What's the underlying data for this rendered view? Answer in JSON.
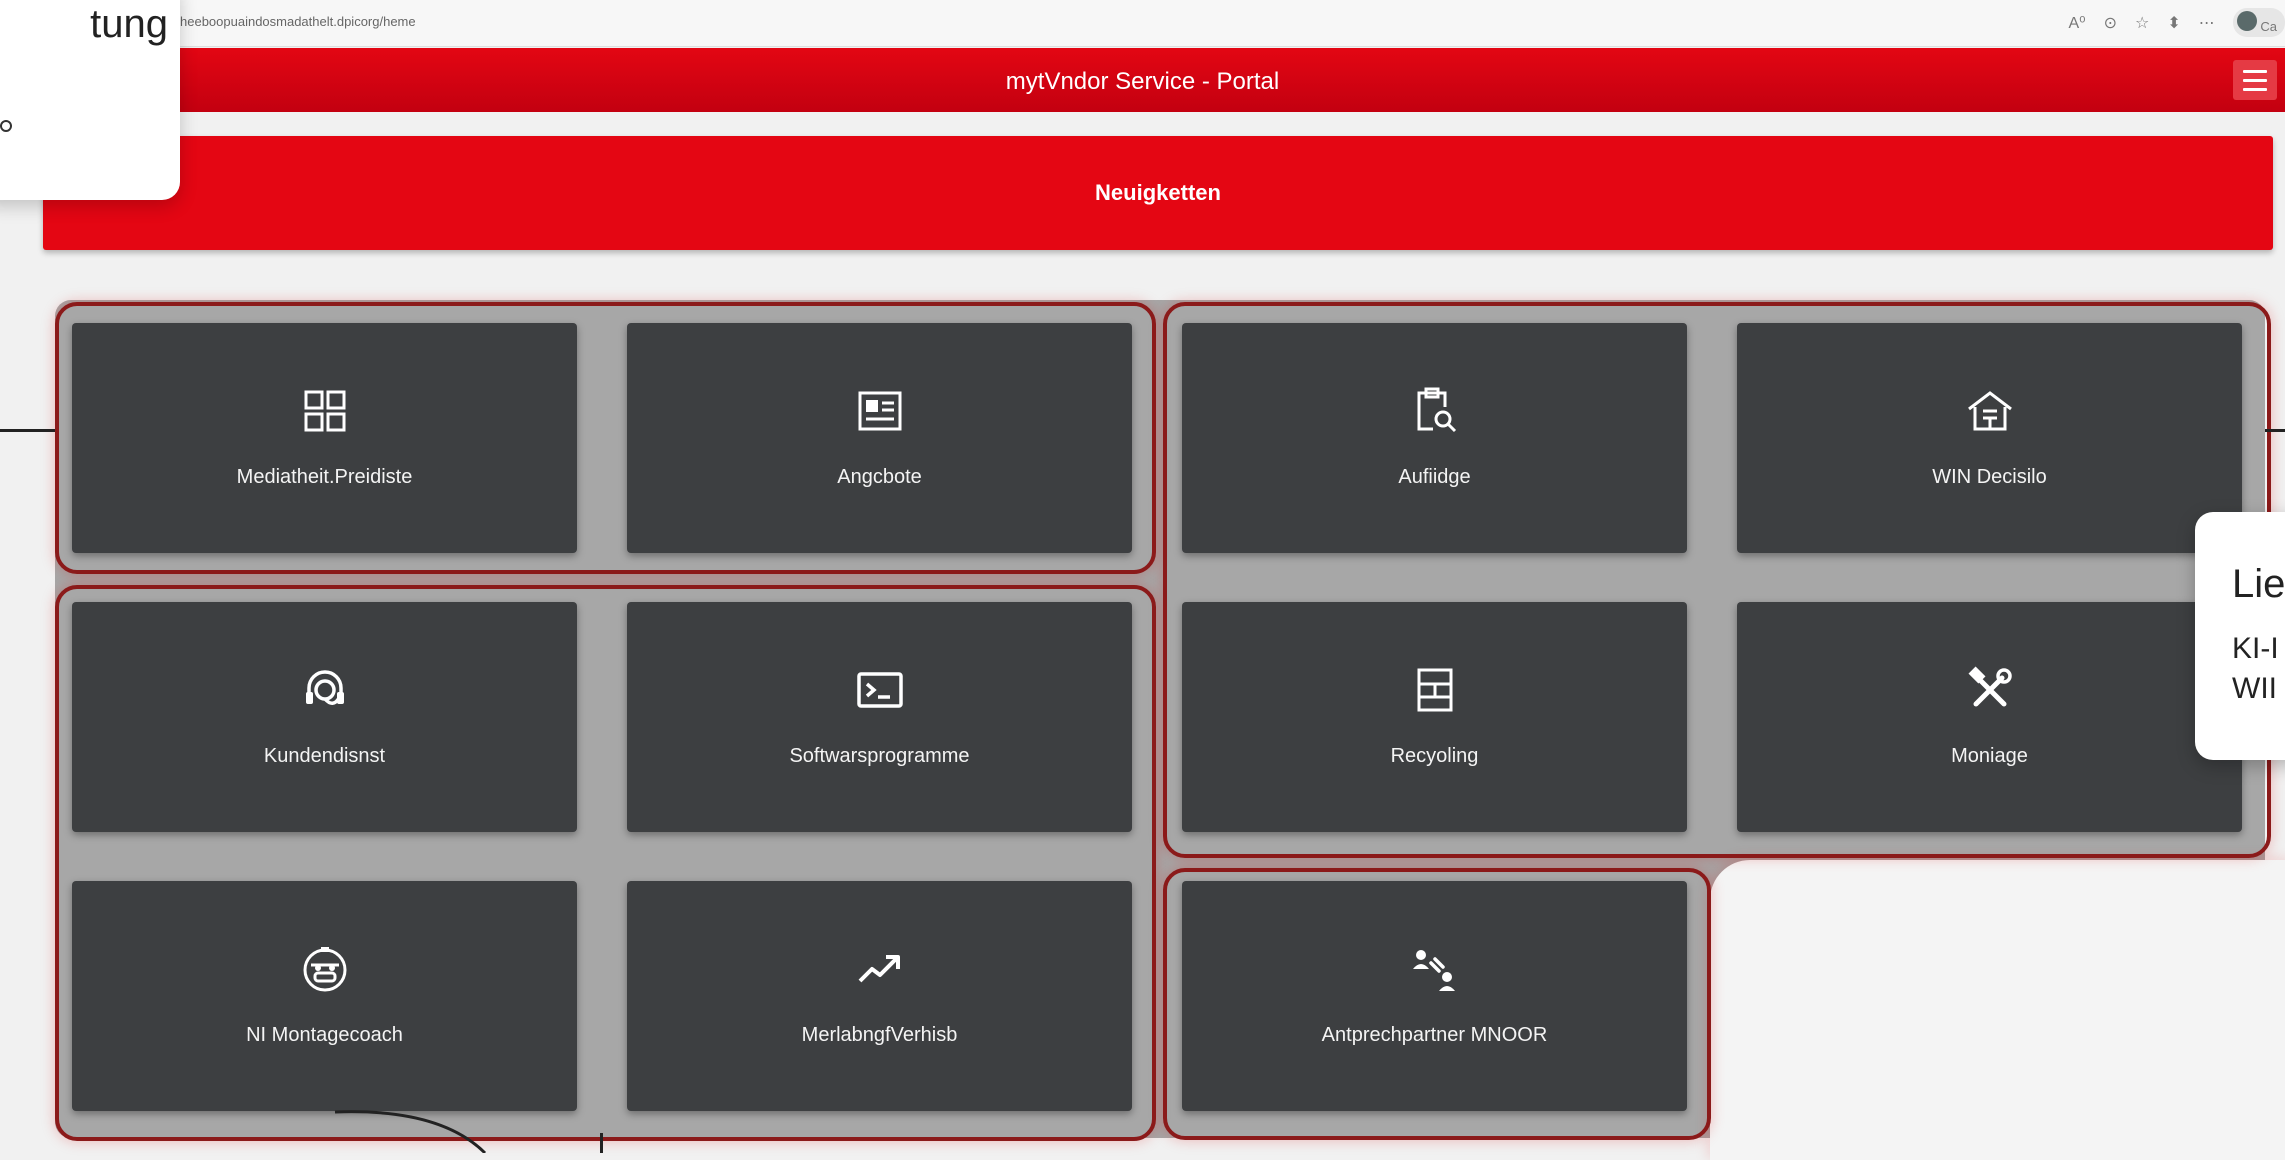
{
  "browser": {
    "url": "heeboopuaindosmadathelt.dpicorg/heme",
    "profile_label": "Ca"
  },
  "header": {
    "title": "mytVndor Service - Portal"
  },
  "news": {
    "label": "Neuigketten"
  },
  "tiles": [
    {
      "label": "Mediatheit.Preidiste",
      "icon": "grid-icon"
    },
    {
      "label": "Angcbote",
      "icon": "document-icon"
    },
    {
      "label": "Aufiidge",
      "icon": "clipboard-search-icon"
    },
    {
      "label": "WIN Decisilo",
      "icon": "house-icon"
    },
    {
      "label": "Kundendisnst",
      "icon": "headset-icon"
    },
    {
      "label": "Softwarsprogramme",
      "icon": "terminal-icon"
    },
    {
      "label": "Recyoling",
      "icon": "shelf-icon"
    },
    {
      "label": "Moniage",
      "icon": "tools-icon"
    },
    {
      "label": "NI Montagecoach",
      "icon": "robot-face-icon"
    },
    {
      "label": "MerlabngfVerhisb",
      "icon": "trending-up-icon"
    },
    {
      "label": "Antprechpartner MNOOR",
      "icon": "contact-people-icon"
    }
  ],
  "overlay_left": {
    "title_fragment": "tung"
  },
  "overlay_right": {
    "title_fragment": "Lie",
    "line1": "KI-I",
    "line2": "WII"
  },
  "colors": {
    "brand_red": "#e30613",
    "tile_bg": "#3d3f41",
    "frame_red": "#8b1a1a"
  }
}
